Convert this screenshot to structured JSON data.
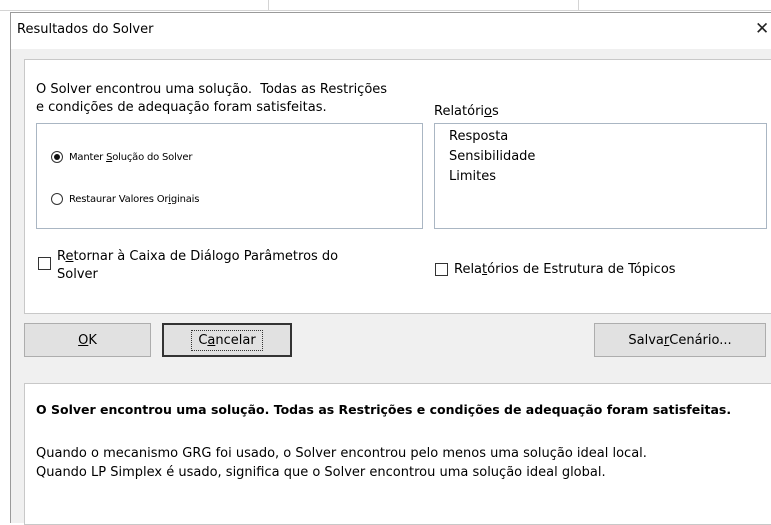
{
  "window": {
    "title": "Resultados do Solver",
    "close_glyph": "✕"
  },
  "result_message": "O Solver encontrou uma solução.  Todas as Restrições\ne condições de adequação foram satisfeitas.",
  "options": {
    "keep": {
      "label": "Manter Solução do Solver",
      "selected": true
    },
    "restore": {
      "label": "Restaurar Valores Originais",
      "selected": false
    }
  },
  "reports": {
    "label": "Relatórios",
    "items": [
      "Resposta",
      "Sensibilidade",
      "Limites"
    ]
  },
  "checkboxes": {
    "return_dialog": {
      "label": "Retornar à Caixa de Diálogo Parâmetros do\nSolver",
      "checked": false
    },
    "outline_reports": {
      "label": "Relatórios de Estrutura de Tópicos",
      "checked": false
    }
  },
  "buttons": {
    "ok": "OK",
    "cancel": "Cancelar",
    "save_scenario": "Salvar Cenário..."
  },
  "description": {
    "headline": "O Solver encontrou uma solução.  Todas as Restrições e condições de adequação foram satisfeitas.",
    "body": "Quando o mecanismo GRG foi usado, o Solver encontrou pelo menos uma solução ideal local.\nQuando LP Simplex é usado, significa que o Solver encontrou uma solução ideal global."
  }
}
